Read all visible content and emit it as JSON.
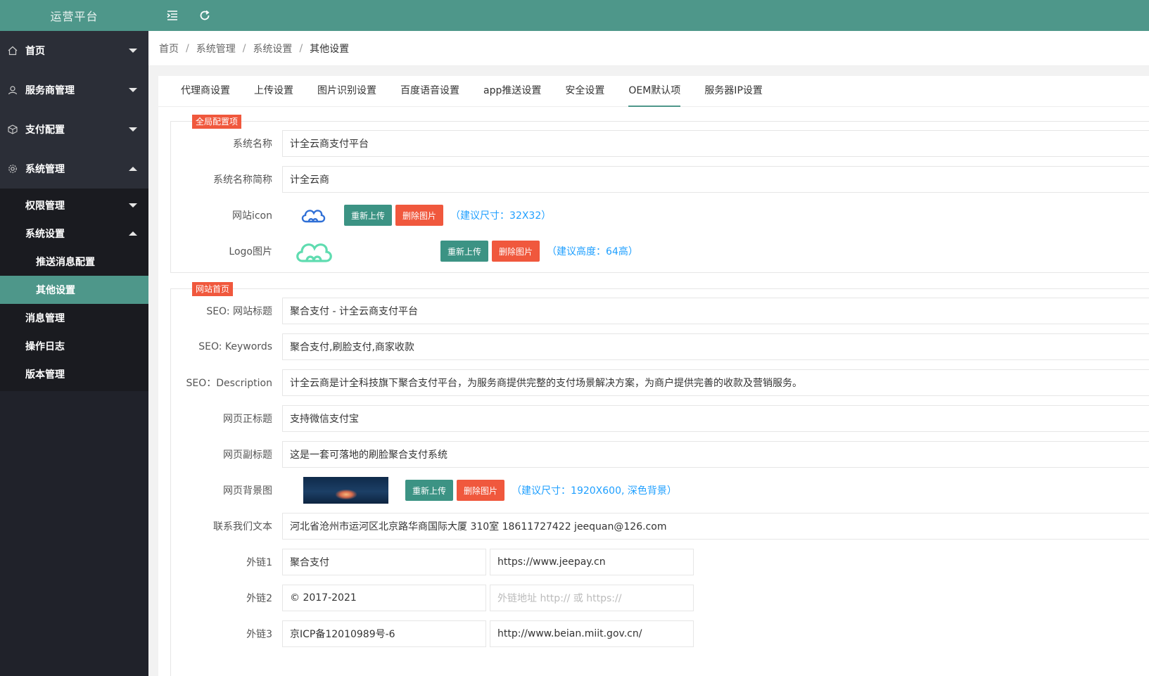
{
  "app": {
    "title": "运营平台"
  },
  "sidebar": {
    "items": [
      {
        "label": "首页",
        "icon": "home-icon",
        "expanded": false
      },
      {
        "label": "服务商管理",
        "icon": "user-icon",
        "expanded": false
      },
      {
        "label": "支付配置",
        "icon": "cube-icon",
        "expanded": false
      },
      {
        "label": "系统管理",
        "icon": "gear-icon",
        "expanded": true
      }
    ],
    "system_children": {
      "permission": "权限管理",
      "settings": "系统设置",
      "push_config": "推送消息配置",
      "other_settings": "其他设置",
      "message": "消息管理",
      "oplog": "操作日志",
      "version": "版本管理"
    }
  },
  "header": {
    "menu_icon": "indent-icon",
    "refresh_icon": "refresh-icon"
  },
  "breadcrumb": [
    "首页",
    "系统管理",
    "系统设置",
    "其他设置"
  ],
  "tabs": [
    "代理商设置",
    "上传设置",
    "图片识别设置",
    "百度语音设置",
    "app推送设置",
    "安全设置",
    "OEM默认项",
    "服务器IP设置"
  ],
  "active_tab": "OEM默认项",
  "global": {
    "legend": "全局配置项",
    "sys_name_label": "系统名称",
    "sys_name": "计全云商支付平台",
    "sys_short_label": "系统名称简称",
    "sys_short": "计全云商",
    "icon_label": "网站icon",
    "icon_hint": "（建议尺寸：32X32）",
    "logo_label": "Logo图片",
    "logo_hint": "（建议高度：64高）"
  },
  "buttons": {
    "reupload": "重新上传",
    "delete": "删除图片"
  },
  "home": {
    "legend": "网站首页",
    "seo_title_label": "SEO: 网站标题",
    "seo_title": "聚合支付 - 计全云商支付平台",
    "seo_kw_label": "SEO: Keywords",
    "seo_kw": "聚合支付,刷脸支付,商家收款",
    "seo_desc_label": "SEO：Description",
    "seo_desc": "计全云商是计全科技旗下聚合支付平台，为服务商提供完整的支付场景解决方案，为商户提供完善的收款及营销服务。",
    "main_title_label": "网页正标题",
    "main_title": "支持微信支付宝",
    "sub_title_label": "网页副标题",
    "sub_title": "这是一套可落地的刷脸聚合支付系统",
    "bg_label": "网页背景图",
    "bg_hint": "（建议尺寸：1920X600, 深色背景）",
    "contact_label": "联系我们文本",
    "contact": "河北省沧州市运河区北京路华商国际大厦 310室 18611727422 jeequan@126.com",
    "link1_label": "外链1",
    "link1_name": "聚合支付",
    "link1_url": "https://www.jeepay.cn",
    "link2_label": "外链2",
    "link2_name": "© 2017-2021",
    "link2_url_placeholder": "外链地址 http:// 或 https://",
    "link3_label": "外链3",
    "link3_name": "京ICP备12010989号-6",
    "link3_url": "http://www.beian.miit.gov.cn/"
  }
}
